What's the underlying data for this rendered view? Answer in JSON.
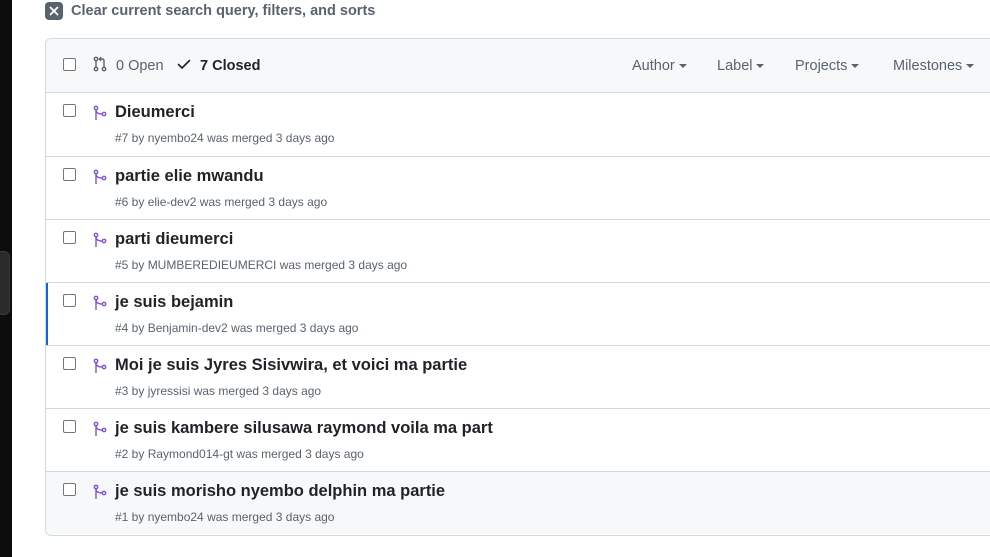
{
  "clear_filters": {
    "label": "Clear current search query, filters, and sorts"
  },
  "header": {
    "open_label": "0 Open",
    "closed_label": "7 Closed",
    "filters": [
      "Author",
      "Label",
      "Projects",
      "Milestones"
    ]
  },
  "colors": {
    "merged": "#8250df",
    "accent": "#0969da",
    "muted": "#59636e"
  },
  "pull_requests": [
    {
      "title": "Dieumerci",
      "meta": "#7 by nyembo24 was merged 3 days ago"
    },
    {
      "title": "partie elie mwandu",
      "meta": "#6 by elie-dev2 was merged 3 days ago"
    },
    {
      "title": "parti dieumerci",
      "meta": "#5 by MUMBEREDIEUMERCI was merged 3 days ago"
    },
    {
      "title": "je suis bejamin",
      "meta": "#4 by Benjamin-dev2 was merged 3 days ago"
    },
    {
      "title": "Moi je suis Jyres Sisivwira, et voici ma partie",
      "meta": "#3 by jyressisi was merged 3 days ago"
    },
    {
      "title": "je suis kambere silusawa raymond voila ma part",
      "meta": "#2 by Raymond014-gt was merged 3 days ago"
    },
    {
      "title": "je suis morisho nyembo delphin ma partie",
      "meta": "#1 by nyembo24 was merged 3 days ago"
    }
  ]
}
